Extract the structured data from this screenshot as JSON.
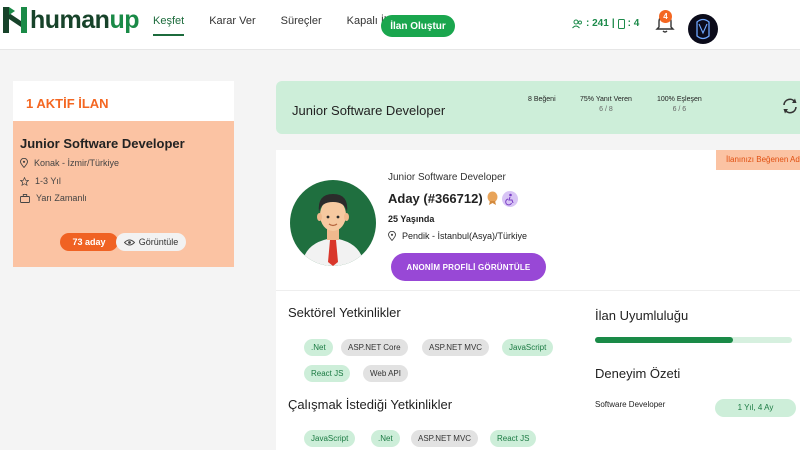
{
  "brand": {
    "part1": "human",
    "part2": "up"
  },
  "nav": {
    "items": [
      {
        "label": "Keşfet",
        "active": true
      },
      {
        "label": "Karar Ver",
        "active": false
      },
      {
        "label": "Süreçler",
        "active": false
      },
      {
        "label": "Kapalı İlanlar",
        "active": false
      }
    ],
    "create_button": "İlan Oluştur"
  },
  "header_stats": {
    "users": "241",
    "devices": "4"
  },
  "notifications": {
    "count": "4"
  },
  "active_listings": {
    "title": "1 AKTİF İLAN",
    "listing": {
      "title": "Junior Software Developer",
      "location": "Konak - İzmir/Türkiye",
      "experience": "1-3 Yıl",
      "work_type": "Yarı Zamanlı",
      "candidate_count": "73 aday",
      "view_label": "Görüntüle"
    }
  },
  "job_bar": {
    "title": "Junior Software Developer",
    "stats": [
      {
        "label": "8 Beğeni",
        "sub": ""
      },
      {
        "label": "75% Yanıt Veren",
        "sub": "6 / 8"
      },
      {
        "label": "100% Eşleşen",
        "sub": "6 / 6"
      }
    ]
  },
  "candidate": {
    "liked_ribbon": "İlanınızı Beğenen Ada",
    "role": "Junior Software Developer",
    "name": "Aday (#366712)",
    "age": "25 Yaşında",
    "location": "Pendik - İstanbul(Asya)/Türkiye",
    "anon_button": "ANONİM PROFİLİ GÖRÜNTÜLE"
  },
  "sector_skills": {
    "title": "Sektörel Yetkinlikler",
    "tags": [
      {
        "label": ".Net",
        "style": "green"
      },
      {
        "label": "ASP.NET Core",
        "style": "gray"
      },
      {
        "label": "ASP.NET MVC",
        "style": "gray"
      },
      {
        "label": "JavaScript",
        "style": "green"
      },
      {
        "label": "React JS",
        "style": "green"
      },
      {
        "label": "Web API",
        "style": "gray"
      }
    ]
  },
  "desired_skills": {
    "title": "Çalışmak İstediği Yetkinlikler",
    "tags": [
      {
        "label": "JavaScript",
        "style": "green"
      },
      {
        "label": ".Net",
        "style": "green"
      },
      {
        "label": "ASP.NET MVC",
        "style": "gray"
      },
      {
        "label": "React JS",
        "style": "green"
      }
    ]
  },
  "compatibility": {
    "title": "İlan Uyumluluğu",
    "percent": 70
  },
  "experience_summary": {
    "title": "Deneyim Özeti",
    "role": "Software Developer",
    "duration": "1 Yıl, 4 Ay"
  },
  "colors": {
    "brand_green": "#1a8a47",
    "accent_orange": "#f46722",
    "purple": "#9848d6"
  }
}
